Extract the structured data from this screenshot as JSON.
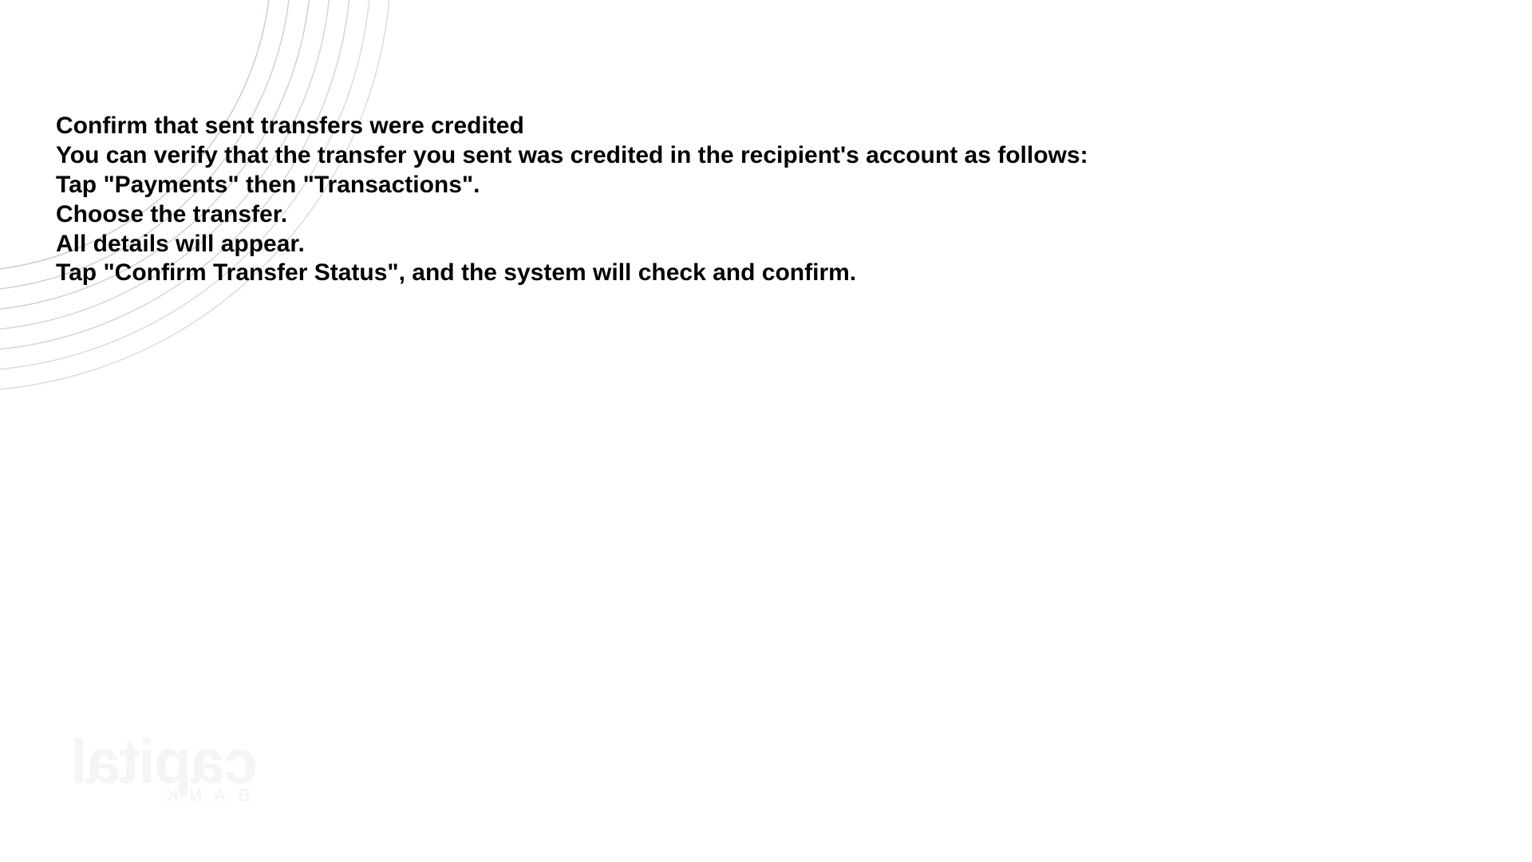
{
  "content": {
    "title": "Confirm that sent transfers were credited",
    "intro": "You can verify that the transfer you sent was credited in the recipient's account as follows:",
    "step1": "Tap \"Payments\" then \"Transactions\".",
    "step2": "Choose the transfer.",
    "step3": "All details will appear.",
    "step4": "Tap \"Confirm Transfer Status\", and the system will check and confirm."
  },
  "watermark": {
    "main": "capital",
    "sub": "BANK"
  }
}
